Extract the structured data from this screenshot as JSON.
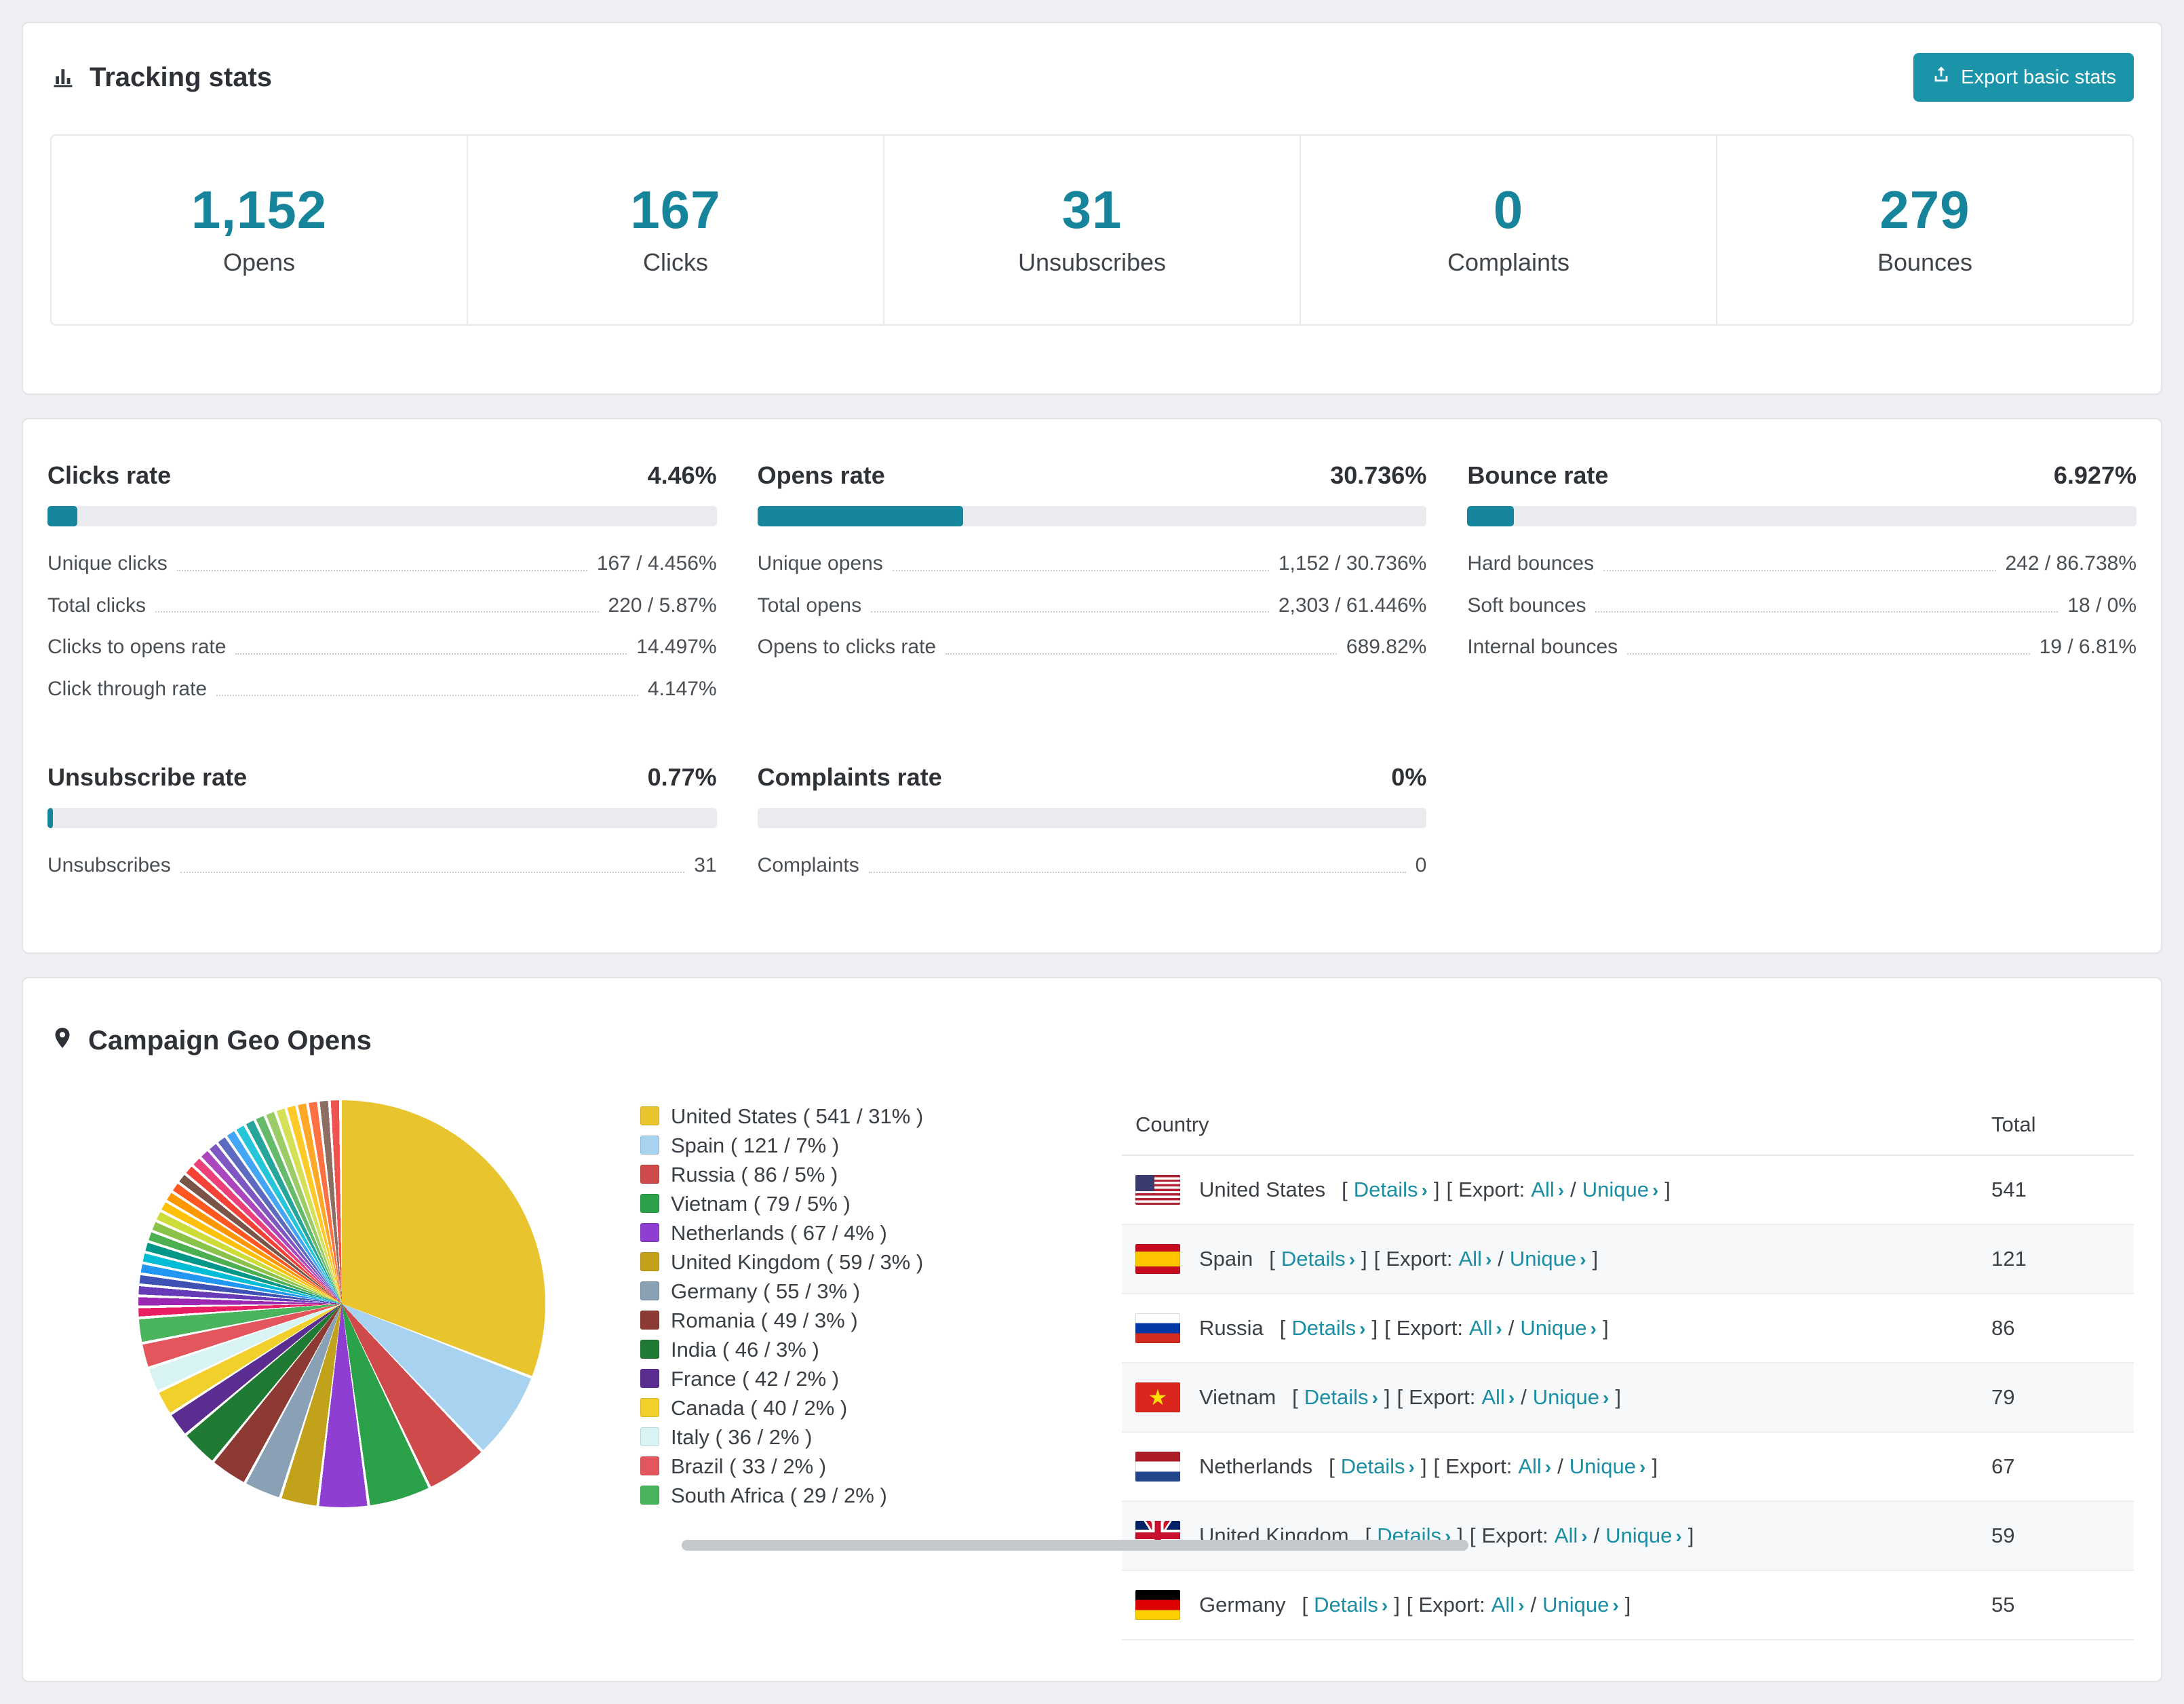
{
  "accent": "#16869c",
  "tracking": {
    "title": "Tracking stats",
    "export_button": "Export basic stats",
    "stats": [
      {
        "value": "1,152",
        "label": "Opens"
      },
      {
        "value": "167",
        "label": "Clicks"
      },
      {
        "value": "31",
        "label": "Unsubscribes"
      },
      {
        "value": "0",
        "label": "Complaints"
      },
      {
        "value": "279",
        "label": "Bounces"
      }
    ]
  },
  "rates": {
    "top": [
      {
        "title": "Clicks rate",
        "value": "4.46%",
        "rows": [
          {
            "label": "Unique clicks",
            "value": "167 / 4.456%"
          },
          {
            "label": "Total clicks",
            "value": "220 / 5.87%"
          },
          {
            "label": "Clicks to opens rate",
            "value": "14.497%"
          },
          {
            "label": "Click through rate",
            "value": "4.147%"
          }
        ]
      },
      {
        "title": "Opens rate",
        "value": "30.736%",
        "rows": [
          {
            "label": "Unique opens",
            "value": "1,152 / 30.736%"
          },
          {
            "label": "Total opens",
            "value": "2,303 / 61.446%"
          },
          {
            "label": "Opens to clicks rate",
            "value": "689.82%"
          }
        ]
      },
      {
        "title": "Bounce rate",
        "value": "6.927%",
        "rows": [
          {
            "label": "Hard bounces",
            "value": "242 / 86.738%"
          },
          {
            "label": "Soft bounces",
            "value": "18 / 0%"
          },
          {
            "label": "Internal bounces",
            "value": "19 / 6.81%"
          }
        ]
      }
    ],
    "bottom": [
      {
        "title": "Unsubscribe rate",
        "value": "0.77%",
        "rows": [
          {
            "label": "Unsubscribes",
            "value": "31"
          }
        ]
      },
      {
        "title": "Complaints rate",
        "value": "0%",
        "rows": [
          {
            "label": "Complaints",
            "value": "0"
          }
        ]
      }
    ]
  },
  "geo": {
    "title": "Campaign Geo Opens",
    "table": {
      "country_header": "Country",
      "total_header": "Total",
      "details_label": "Details",
      "export_label": "Export:",
      "all_label": "All",
      "unique_label": "Unique",
      "open_bracket": "[",
      "close_bracket": "]",
      "slash": "/",
      "chevron": "›",
      "rows": [
        {
          "country": "United States",
          "total": "541",
          "flag": "us"
        },
        {
          "country": "Spain",
          "total": "121",
          "flag": "es"
        },
        {
          "country": "Russia",
          "total": "86",
          "flag": "ru"
        },
        {
          "country": "Vietnam",
          "total": "79",
          "flag": "vn"
        },
        {
          "country": "Netherlands",
          "total": "67",
          "flag": "nl"
        },
        {
          "country": "United Kingdom",
          "total": "59",
          "flag": "gb"
        },
        {
          "country": "Germany",
          "total": "55",
          "flag": "de"
        }
      ]
    },
    "chart_data": {
      "type": "pie",
      "title": "Campaign Geo Opens",
      "legend_position": "right",
      "slices": [
        {
          "label": "United States",
          "value": 541,
          "pct": 31,
          "color": "#e8c52e",
          "display": "United States ( 541 / 31% )"
        },
        {
          "label": "Spain",
          "value": 121,
          "pct": 7,
          "color": "#a8d3f0",
          "display": "Spain ( 121 / 7% )"
        },
        {
          "label": "Russia",
          "value": 86,
          "pct": 5,
          "color": "#cf4a4a",
          "display": "Russia ( 86 / 5% )"
        },
        {
          "label": "Vietnam",
          "value": 79,
          "pct": 5,
          "color": "#2ba14a",
          "display": "Vietnam ( 79 / 5% )"
        },
        {
          "label": "Netherlands",
          "value": 67,
          "pct": 4,
          "color": "#8e3fd1",
          "display": "Netherlands ( 67 / 4% )"
        },
        {
          "label": "United Kingdom",
          "value": 59,
          "pct": 3,
          "color": "#c3a21b",
          "display": "United Kingdom ( 59 / 3% )"
        },
        {
          "label": "Germany",
          "value": 55,
          "pct": 3,
          "color": "#8aa0b4",
          "display": "Germany ( 55 / 3% )"
        },
        {
          "label": "Romania",
          "value": 49,
          "pct": 3,
          "color": "#8e3a34",
          "display": "Romania ( 49 / 3% )"
        },
        {
          "label": "India",
          "value": 46,
          "pct": 3,
          "color": "#1f7a33",
          "display": "India ( 46 / 3% )"
        },
        {
          "label": "France",
          "value": 42,
          "pct": 2,
          "color": "#5c2d91",
          "display": "France ( 42 / 2% )"
        },
        {
          "label": "Canada",
          "value": 40,
          "pct": 2,
          "color": "#f2d02c",
          "display": "Canada ( 40 / 2% )"
        },
        {
          "label": "Italy",
          "value": 36,
          "pct": 2,
          "color": "#d8f3f3",
          "display": "Italy ( 36 / 2% )"
        },
        {
          "label": "Brazil",
          "value": 33,
          "pct": 2,
          "color": "#e4565e",
          "display": "Brazil ( 33 / 2% )"
        },
        {
          "label": "South Africa",
          "value": 29,
          "pct": 2,
          "color": "#49b45c",
          "display": "South Africa ( 29 / 2% )"
        }
      ],
      "others": {
        "label": "Other countries (small unlabeled slices)",
        "pct_total": 26,
        "colors": [
          "#e91e63",
          "#9c27b0",
          "#673ab7",
          "#3f51b5",
          "#2196f3",
          "#00bcd4",
          "#009688",
          "#4caf50",
          "#8bc34a",
          "#cddc39",
          "#ffc107",
          "#ff9800",
          "#ff5722",
          "#795548",
          "#f44336",
          "#ec407a",
          "#ab47bc",
          "#7e57c2",
          "#5c6bc0",
          "#42a5f5",
          "#26c6da",
          "#26a69a",
          "#66bb6a",
          "#9ccc65",
          "#d4e157",
          "#ffca28",
          "#ffa726",
          "#ff7043",
          "#8d6e63",
          "#ef5350"
        ]
      }
    }
  }
}
